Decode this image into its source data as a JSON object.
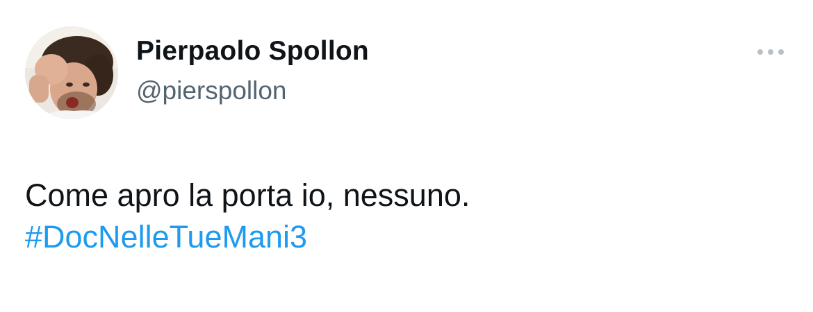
{
  "author": {
    "display_name": "Pierpaolo Spollon",
    "handle": "@pierspollon",
    "avatar_icon": "profile-photo"
  },
  "menu": {
    "icon": "more-horizontal-icon"
  },
  "tweet": {
    "text": "Come apro la porta io, nessuno.",
    "hashtag": "#DocNelleTueMani3"
  },
  "colors": {
    "text_primary": "#0f1419",
    "text_secondary": "#536471",
    "link": "#1d9bf0",
    "background": "#ffffff"
  }
}
